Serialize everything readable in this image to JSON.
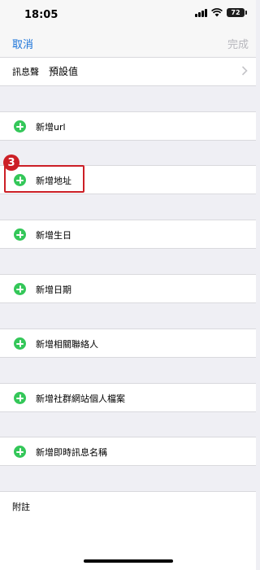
{
  "status_bar": {
    "time": "18:05",
    "battery": "72"
  },
  "nav": {
    "cancel": "取消",
    "done": "完成"
  },
  "ringtone": {
    "label": "訊息聲",
    "value": "預設值"
  },
  "add_rows": [
    "新增url",
    "新增地址",
    "新增生日",
    "新增日期",
    "新增相關聯絡人",
    "新增社群網站個人檔案",
    "新增即時訊息名稱"
  ],
  "annotation": {
    "step": "3"
  },
  "notes": {
    "label": "附註"
  }
}
